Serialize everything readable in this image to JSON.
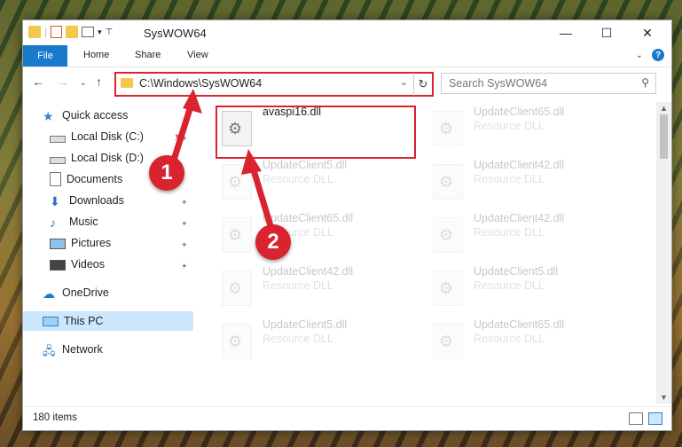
{
  "window": {
    "title": "SysWOW64"
  },
  "ribbon": {
    "file": "File",
    "home": "Home",
    "share": "Share",
    "view": "View"
  },
  "address": {
    "path": "C:\\Windows\\SysWOW64"
  },
  "search": {
    "placeholder": "Search SysWOW64"
  },
  "sidebar": {
    "items": [
      {
        "label": "Quick access",
        "icon": "star-icon"
      },
      {
        "label": "Local Disk (C:)",
        "icon": "drive-icon"
      },
      {
        "label": "Local Disk (D:)",
        "icon": "drive-icon"
      },
      {
        "label": "Documents",
        "icon": "documents-icon"
      },
      {
        "label": "Downloads",
        "icon": "downloads-icon"
      },
      {
        "label": "Music",
        "icon": "music-icon"
      },
      {
        "label": "Pictures",
        "icon": "pictures-icon"
      },
      {
        "label": "Videos",
        "icon": "videos-icon"
      },
      {
        "label": "OneDrive",
        "icon": "cloud-icon"
      },
      {
        "label": "This PC",
        "icon": "pc-icon"
      },
      {
        "label": "Network",
        "icon": "network-icon"
      }
    ]
  },
  "files": [
    {
      "name": "avaspi16.dll",
      "type": ""
    },
    {
      "name": "UpdateClient65.dll",
      "type": "Resource DLL"
    },
    {
      "name": "UpdateClient5.dll",
      "type": "Resource DLL"
    },
    {
      "name": "UpdateClient42.dll",
      "type": "Resource DLL"
    },
    {
      "name": "UpdateClient65.dll",
      "type": "Resource DLL"
    },
    {
      "name": "UpdateClient42.dll",
      "type": "Resource DLL"
    },
    {
      "name": "UpdateClient42.dll",
      "type": "Resource DLL"
    },
    {
      "name": "UpdateClient5.dll",
      "type": "Resource DLL"
    },
    {
      "name": "UpdateClient5.dll",
      "type": "Resource DLL"
    },
    {
      "name": "UpdateClient65.dll",
      "type": "Resource DLL"
    }
  ],
  "status": {
    "items": "180 items"
  },
  "annotations": {
    "step1": "1",
    "step2": "2"
  },
  "colors": {
    "accent": "#1979ca",
    "highlight": "#d9232e",
    "selected": "#cce8ff"
  }
}
